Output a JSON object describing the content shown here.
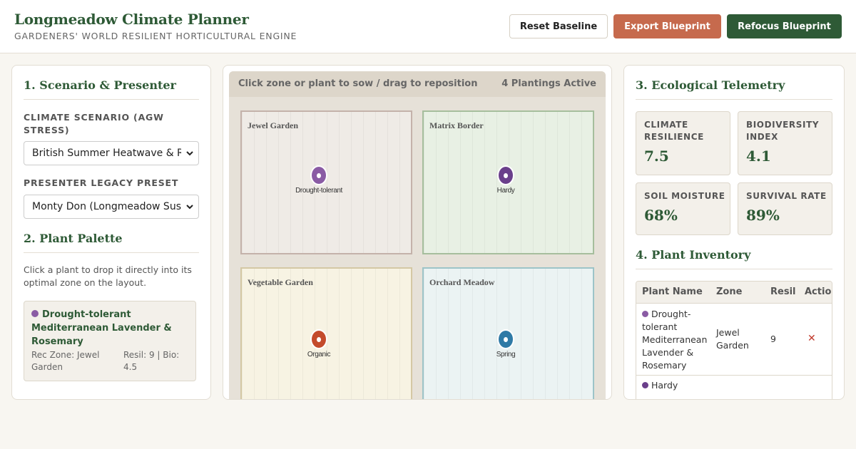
{
  "header": {
    "title": "Longmeadow Climate Planner",
    "subtitle": "GARDENERS' WORLD RESILIENT HORTICULTURAL ENGINE",
    "reset_label": "Reset Baseline",
    "export_label": "Export Blueprint",
    "refocus_label": "Refocus Blueprint"
  },
  "scenario": {
    "section_title": "1. Scenario & Presenter",
    "climate_label": "CLIMATE SCENARIO (AGW STRESS)",
    "climate_value": "British Summer Heatwave & RHS",
    "presenter_label": "PRESENTER LEGACY PRESET",
    "presenter_value": "Monty Don (Longmeadow Sustainable)"
  },
  "palette": {
    "section_title": "2. Plant Palette",
    "help": "Click a plant to drop it directly into its optimal zone on the layout.",
    "items": [
      {
        "name": "Drought-tolerant Mediterranean Lavender & Rosemary",
        "zone": "Rec Zone: Jewel Garden",
        "stats": "Resil: 9 | Bio: 4.5",
        "color": "#8a5ba4"
      }
    ]
  },
  "canvas": {
    "hint": "Click zone or plant to sow / drag to reposition",
    "count": "4 Plantings Active",
    "zones": [
      {
        "name": "Jewel Garden",
        "bg": "#efebe6",
        "border": "#c4b2aa",
        "marker_label": "Drought-tolerant",
        "marker_color": "#8a5ba4"
      },
      {
        "name": "Matrix Border",
        "bg": "#e8f0e4",
        "border": "#a6be9d",
        "marker_label": "Hardy",
        "marker_color": "#6a3f8b"
      },
      {
        "name": "Vegetable Garden",
        "bg": "#f7f3e3",
        "border": "#d4c8a4",
        "marker_label": "Organic",
        "marker_color": "#c44b2c"
      },
      {
        "name": "Orchard Meadow",
        "bg": "#ebf3f3",
        "border": "#9cc4c8",
        "marker_label": "Spring",
        "marker_color": "#2f7aa6"
      }
    ]
  },
  "telemetry": {
    "section_title": "3. Ecological Telemetry",
    "metrics": [
      {
        "label": "CLIMATE RESILIENCE",
        "value": "7.5"
      },
      {
        "label": "BIODIVERSITY INDEX",
        "value": "4.1"
      },
      {
        "label": "SOIL MOISTURE",
        "value": "68%"
      },
      {
        "label": "SURVIVAL RATE",
        "value": "89%"
      }
    ]
  },
  "inventory": {
    "section_title": "4. Plant Inventory",
    "columns": [
      "Plant Name",
      "Zone",
      "Resil",
      "Action"
    ],
    "rows": [
      {
        "name": "Drought-tolerant Mediterranean Lavender & Rosemary",
        "zone": "Jewel Garden",
        "resil": "9",
        "action": "✕",
        "color": "#8a5ba4"
      },
      {
        "name": "Hardy",
        "zone": "",
        "resil": "",
        "action": "",
        "color": "#6a3f8b"
      }
    ]
  }
}
